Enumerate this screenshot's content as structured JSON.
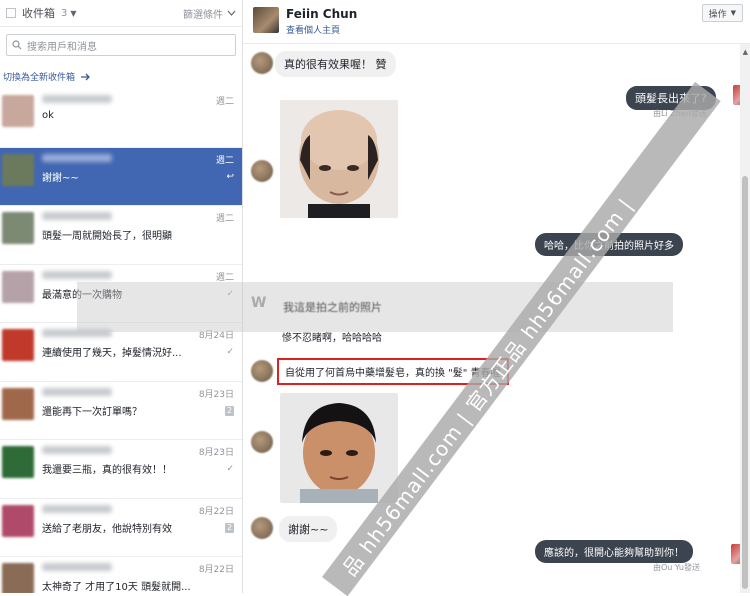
{
  "inbox": {
    "title": "收件箱",
    "count": "3",
    "filter_label": "篩選條件",
    "search_placeholder": "搜索用戶和消息",
    "switch_link": "切換為全新收件箱"
  },
  "conversations": [
    {
      "date": "週二",
      "preview": "ok",
      "status": "",
      "avatar_color": "#c8a79c",
      "active": false
    },
    {
      "date": "週二",
      "preview": "謝謝~~",
      "status": "↩",
      "avatar_color": "#6b7a5c",
      "active": true
    },
    {
      "date": "週二",
      "preview": "頭髮一周就開始長了，很明顯",
      "status": "",
      "avatar_color": "#7c8a74",
      "active": false
    },
    {
      "date": "週二",
      "preview": "最滿意的一次購物",
      "status": "✓",
      "avatar_color": "#b5a2a8",
      "active": false
    },
    {
      "date": "8月24日",
      "preview": "連續使用了幾天，掉髮情況好...",
      "status": "✓",
      "avatar_color": "#c0392b",
      "active": false
    },
    {
      "date": "8月23日",
      "preview": "還能再下一次訂單嗎？",
      "status": "2",
      "avatar_color": "#a0684a",
      "active": false
    },
    {
      "date": "8月23日",
      "preview": "我還要三瓶，真的很有效！！",
      "status": "✓",
      "avatar_color": "#2e6b36",
      "active": false
    },
    {
      "date": "8月22日",
      "preview": "送給了老朋友，他說特別有效",
      "status": "2",
      "avatar_color": "#b04a6a",
      "active": false
    },
    {
      "date": "8月22日",
      "preview": "太神奇了 才用了10天 頭髮就開...",
      "status": "",
      "avatar_color": "#8a6b55",
      "active": false
    }
  ],
  "chat": {
    "name": "Feiin Chun",
    "subtitle": "查看個人主頁",
    "action_label": "操作",
    "messages": {
      "in_1": "真的很有效果喔！ 贊",
      "out_1": "頭髮長出來了?",
      "sent_by_1": "由Li Zhen發送",
      "out_2": "哈哈，比你之前拍的照片好多",
      "in_2": "我這是拍之前的照片",
      "in_3": "慘不忍睹啊，哈哈哈哈",
      "highlight": "自從用了何首烏中藥增髮皂，真的換 \"髮\" 青春喔",
      "in_4": "謝謝~~",
      "out_3": "應該的，很開心能夠幫助到你！",
      "sent_by_2": "由Ou Yu發送"
    }
  },
  "watermark": {
    "text": "品 hh56mall.com | 官方正品 hh56mall.com |",
    "overlay_icon": "W"
  }
}
